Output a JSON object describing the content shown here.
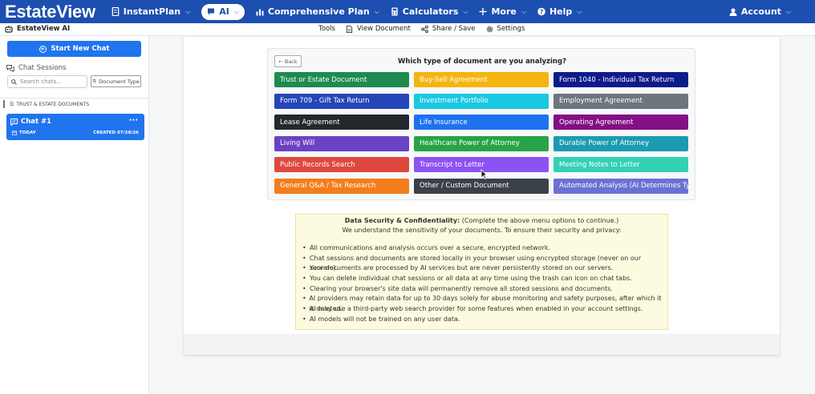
{
  "nav": {
    "logo": "EstateView",
    "items": [
      {
        "label": "InstantPlan",
        "icon": "document-icon"
      },
      {
        "label": "AI",
        "icon": "chat-icon",
        "active": true
      },
      {
        "label": "Comprehensive Plan",
        "icon": "bar-chart-icon"
      },
      {
        "label": "Calculators",
        "icon": "calculator-icon"
      },
      {
        "label": "More",
        "icon": "plus-icon"
      },
      {
        "label": "Help",
        "icon": "help-icon"
      }
    ],
    "account_label": "Account"
  },
  "subbar": {
    "brand": "EstateView AI",
    "tools": [
      "Tools",
      "View Document",
      "Share / Save",
      "Settings"
    ]
  },
  "sidebar": {
    "new_chat_label": "Start New Chat",
    "sessions_heading": "Chat Sessions",
    "search_placeholder": "Search chats...",
    "doc_type_label": "Document Type",
    "group_label": "TRUST & ESTATE DOCUMENTS",
    "chat": {
      "title": "Chat #1",
      "day": "TODAY",
      "created": "CREATED 07/28/26",
      "menu": "···"
    }
  },
  "doc_selector": {
    "back_label": "← Back",
    "question": "Which type of document are you analyzing?",
    "buttons": [
      {
        "label": "Trust or Estate Document",
        "color": "#1e8a50"
      },
      {
        "label": "Buy-Sell Agreement",
        "color": "#f5b50f"
      },
      {
        "label": "Form 1040 - Individual Tax Return",
        "color": "#0c1b8a"
      },
      {
        "label": "Form 709 - Gift Tax Return",
        "color": "#2546b8"
      },
      {
        "label": "Investment Portfolio",
        "color": "#19c8e2"
      },
      {
        "label": "Employment Agreement",
        "color": "#6d757d"
      },
      {
        "label": "Lease Agreement",
        "color": "#23282d"
      },
      {
        "label": "Life Insurance",
        "color": "#1d72f0"
      },
      {
        "label": "Operating Agreement",
        "color": "#840f86"
      },
      {
        "label": "Living Will",
        "color": "#6a42c4"
      },
      {
        "label": "Healthcare Power of Attorney",
        "color": "#27a447"
      },
      {
        "label": "Durable Power of Attorney",
        "color": "#1b9bb1"
      },
      {
        "label": "Public Records Search",
        "color": "#e0483e"
      },
      {
        "label": "Transcript to Letter",
        "color": "#8c52f5"
      },
      {
        "label": "Meeting Notes to Letter",
        "color": "#33d1b3"
      },
      {
        "label": "General Q&A / Tax Research",
        "color": "#f47d1b"
      },
      {
        "label": "Other / Custom Document",
        "color": "#3a4047"
      },
      {
        "label": "Automated Analysis (AI Determines Type)",
        "color": "#6b71d4"
      }
    ]
  },
  "security": {
    "title_bold": "Data Security & Confidentiality:",
    "title_rest": " (Complete the above menu options to continue.)",
    "subtitle": "We understand the sensitivity of your documents. To ensure their security and privacy:",
    "items": [
      "All communications and analysis occurs over a secure, encrypted network.",
      "Chat sessions and documents are stored locally in your browser using encrypted storage (never on our servers).",
      "Your documents are processed by AI services but are never persistently stored on our servers.",
      "You can delete individual chat sessions or all data at any time using the trash can icon on chat tabs.",
      "Clearing your browser's site data will permanently remove all stored sessions and documents.",
      "AI providers may retain data for up to 30 days solely for abuse monitoring and safety purposes, after which it is deleted.",
      "AI may use a third-party web search provider for some features when enabled in your account settings.",
      "AI models will not be trained on any user data."
    ]
  }
}
